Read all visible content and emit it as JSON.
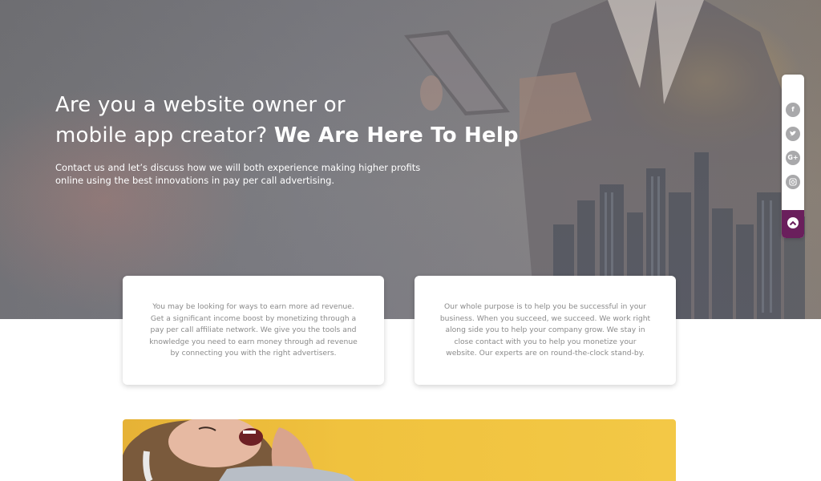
{
  "hero": {
    "title_line1": "Are you a website owner or",
    "title_line2": "mobile app creator?",
    "title_strong": "We Are Here To Help",
    "description": "Contact us and let’s discuss how we will both experience making higher profits online using the best innovations in pay per call advertising."
  },
  "social": {
    "items": [
      {
        "icon": "facebook-icon",
        "glyph": "f"
      },
      {
        "icon": "twitter-icon",
        "glyph": "t"
      },
      {
        "icon": "google-plus-icon",
        "glyph": "G+"
      },
      {
        "icon": "instagram-icon",
        "glyph": "◎"
      }
    ],
    "scroll_top_icon": "chevron-up-icon",
    "accent_color": "#6a1f5c"
  },
  "cards": [
    {
      "text": "You may be looking for ways to earn more ad revenue. Get a significant income boost by monetizing through a pay per call affiliate network. We give you the tools and knowledge you need to earn money through ad revenue by connecting you with the right advertisers."
    },
    {
      "text": "Our whole purpose is to help you be successful in your business. When you succeed, we succeed. We work right along side you to help your company grow. We stay in close contact with you to help you monetize your website. Our experts are on round-the-clock stand-by."
    }
  ],
  "banner": {
    "background_color": "#f0c23e"
  }
}
